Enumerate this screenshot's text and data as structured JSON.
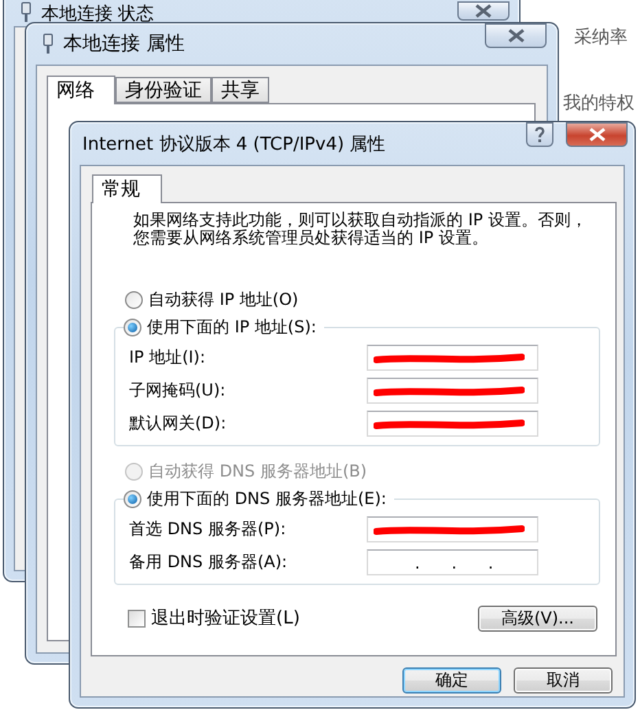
{
  "backdrop": {
    "texts": [
      "采纳率",
      "我的特权"
    ]
  },
  "status_window": {
    "title": "本地连接 状态"
  },
  "properties_window": {
    "title": "本地连接 属性",
    "tabs": [
      {
        "label": "网络",
        "selected": true
      },
      {
        "label": "身份验证",
        "selected": false
      },
      {
        "label": "共享",
        "selected": false
      }
    ]
  },
  "ipv4_window": {
    "title": "Internet 协议版本 4 (TCP/IPv4) 属性",
    "tabs": [
      {
        "label": "常规",
        "selected": true
      }
    ],
    "description": [
      "如果网络支持此功能，则可以获取自动指派的 IP 设置。否则，",
      "您需要从网络系统管理员处获得适当的 IP 设置。"
    ],
    "ip_options": [
      {
        "label": "自动获得 IP 地址(O)",
        "selected": false,
        "disabled": false
      },
      {
        "label": "使用下面的 IP 地址(S):",
        "selected": true,
        "disabled": false
      }
    ],
    "ip_fields": [
      {
        "label": "IP 地址(I):",
        "redacted": true
      },
      {
        "label": "子网掩码(U):",
        "redacted": true
      },
      {
        "label": "默认网关(D):",
        "redacted": true
      }
    ],
    "dns_options": [
      {
        "label": "自动获得 DNS 服务器地址(B)",
        "selected": false,
        "disabled": true
      },
      {
        "label": "使用下面的 DNS 服务器地址(E):",
        "selected": true,
        "disabled": false
      }
    ],
    "dns_fields": [
      {
        "label": "首选 DNS 服务器(P):",
        "redacted": true
      },
      {
        "label": "备用 DNS 服务器(A):",
        "redacted": false,
        "value": ".      .      ."
      }
    ],
    "validate_checkbox": {
      "label": "退出时验证设置(L)",
      "checked": false
    },
    "advanced_button": "高级(V)...",
    "buttons": [
      {
        "label": "确定",
        "default": true
      },
      {
        "label": "取消",
        "default": false
      }
    ]
  }
}
